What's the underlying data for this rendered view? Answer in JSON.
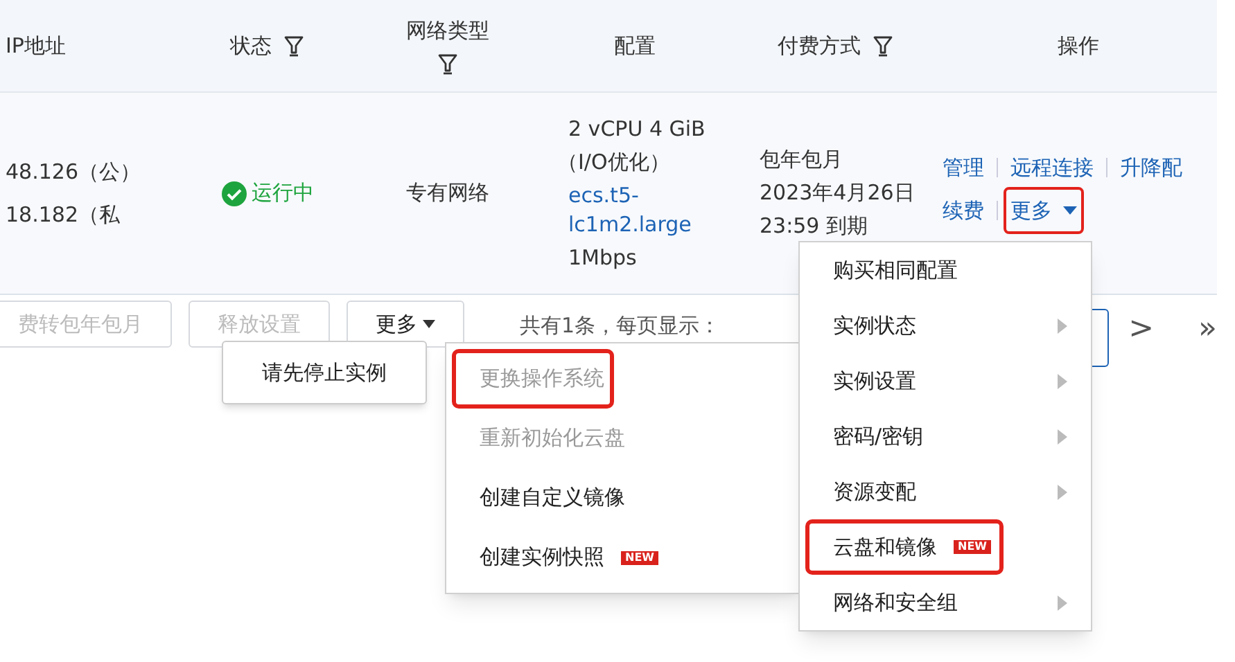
{
  "table": {
    "columns": [
      {
        "label": "IP地址",
        "filter": false
      },
      {
        "label": "状态",
        "filter": true
      },
      {
        "label": "网络类型",
        "filter": true
      },
      {
        "label": "配置",
        "filter": false
      },
      {
        "label": "付费方式",
        "filter": true
      },
      {
        "label": "操作",
        "filter": false
      }
    ],
    "rows": [
      {
        "ip": [
          "48.126（公）",
          "18.182（私"
        ],
        "status": "运行中",
        "network": "专有网络",
        "config": [
          "2 vCPU 4 GiB",
          "（I/O优化）"
        ],
        "instance_type": "ecs.t5-lc1m2.large",
        "bandwidth": "1Mbps",
        "billing": [
          "包年包月",
          "2023年4月26日",
          "23:59 到期"
        ],
        "actions": [
          {
            "label": "管理",
            "kind": "link",
            "highlighted": false
          },
          {
            "label": "远程连接",
            "kind": "link",
            "highlighted": false
          },
          {
            "label": "升降配",
            "kind": "link",
            "highlighted": false
          },
          {
            "label": "续费",
            "kind": "link",
            "highlighted": false
          },
          {
            "label": "更多",
            "kind": "dropdown",
            "highlighted": true
          }
        ]
      }
    ]
  },
  "toolbar": {
    "buttons": [
      {
        "label": "费转包年包月",
        "disabled": true,
        "kind": "plain"
      },
      {
        "label": "释放设置",
        "disabled": true,
        "kind": "plain"
      },
      {
        "label": "更多",
        "disabled": false,
        "kind": "dropdown"
      }
    ],
    "total": "共有1条，每页显示：",
    "pager": [
      ">",
      "»"
    ]
  },
  "tooltip": {
    "text": "请先停止实例"
  },
  "more_menu": {
    "items": [
      {
        "label": "购买相同配置",
        "submenu": false,
        "highlighted": false
      },
      {
        "label": "实例状态",
        "submenu": true,
        "highlighted": false
      },
      {
        "label": "实例设置",
        "submenu": true,
        "highlighted": false
      },
      {
        "label": "密码/密钥",
        "submenu": true,
        "highlighted": false
      },
      {
        "label": "资源变配",
        "submenu": true,
        "highlighted": false
      },
      {
        "label": "云盘和镜像",
        "submenu": false,
        "badge": "NEW",
        "highlighted": true
      },
      {
        "label": "网络和安全组",
        "submenu": true,
        "highlighted": false
      }
    ]
  },
  "submenu": {
    "items": [
      {
        "label": "更换操作系统",
        "disabled": true,
        "highlighted": true
      },
      {
        "label": "重新初始化云盘",
        "disabled": true,
        "highlighted": false
      },
      {
        "label": "创建自定义镜像",
        "disabled": false,
        "highlighted": false
      },
      {
        "label": "创建实例快照",
        "disabled": false,
        "badge": "NEW",
        "highlighted": false
      }
    ]
  }
}
